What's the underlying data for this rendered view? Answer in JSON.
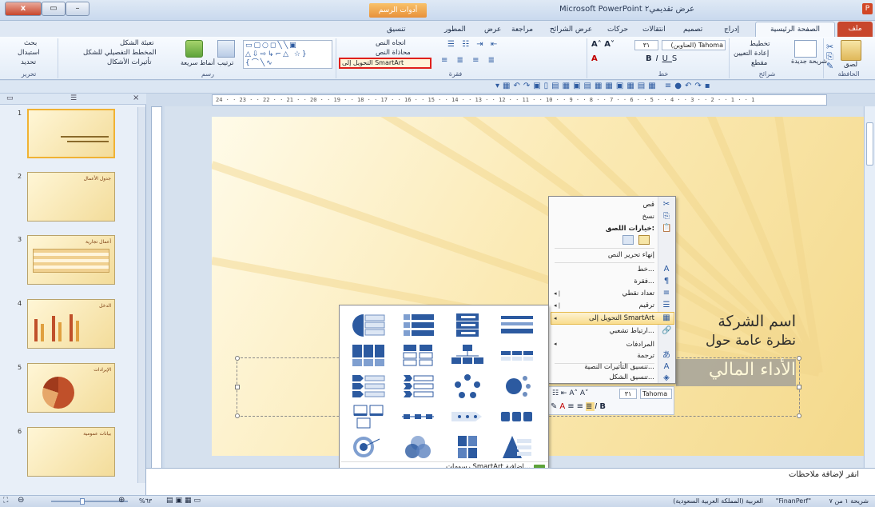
{
  "window": {
    "app_title": "Microsoft PowerPoint   عرض تقديمي٢",
    "context_tab": "أدوات الرسم",
    "logo": "P",
    "controls": [
      "x",
      "▭",
      "–"
    ]
  },
  "tabs": [
    {
      "id": "file",
      "label": "ملف"
    },
    {
      "id": "home",
      "label": "الصفحة الرئيسية"
    },
    {
      "id": "insert",
      "label": "إدراج"
    },
    {
      "id": "design",
      "label": "تصميم"
    },
    {
      "id": "transitions",
      "label": "انتقالات"
    },
    {
      "id": "animations",
      "label": "حركات"
    },
    {
      "id": "slideshow",
      "label": "عرض الشرائح"
    },
    {
      "id": "review",
      "label": "مراجعة"
    },
    {
      "id": "view",
      "label": "عرض"
    },
    {
      "id": "developer",
      "label": "المطور"
    },
    {
      "id": "format",
      "label": "تنسيق"
    }
  ],
  "ribbon": {
    "clipboard": {
      "group": "الحافظة",
      "paste": "لصق"
    },
    "slides": {
      "group": "شرائح",
      "new_slide": "شريحة جديدة",
      "layout": "تخطيط",
      "reset": "إعادة التعيين",
      "section": "مقطع"
    },
    "font": {
      "group": "خط",
      "font_name": "(العناوين) Tahoma",
      "font_size": "٣١"
    },
    "paragraph": {
      "group": "فقرة",
      "text_direction": "اتجاه النص",
      "align_text": "محاذاة النص",
      "convert_smartart": "التحويل إلى SmartArt"
    },
    "drawing": {
      "group": "رسم",
      "arrange": "ترتيب",
      "quick_styles": "أنماط سريعة",
      "fill": "تعبئة الشكل",
      "outline": "المخطط التفصيلي للشكل",
      "effects": "تأثيرات الأشكال"
    },
    "editing": {
      "group": "تحرير",
      "find": "بحث",
      "replace": "استبدال",
      "select": "تحديد"
    }
  },
  "ruler_text": "24 · · 23 · · 22 · · 21 · · 20 · · 19 · · 18 · · 17 · · 16 · · 15 · · 14 · · 13 · · 12 · · 11 · · 10 · · 9 · · 8 · · 7 · · 6 · · 5 · · 4 · · 3 · · 2 · · 1 · · 1",
  "slides_pane": {
    "thumbs": [
      {
        "num": "1",
        "title": "",
        "selected": true
      },
      {
        "num": "2",
        "title": "جدول الأعمال"
      },
      {
        "num": "3",
        "title": "أعمال تجارية"
      },
      {
        "num": "4",
        "title": "الدخل"
      },
      {
        "num": "5",
        "title": "الإيرادات"
      },
      {
        "num": "6",
        "title": "بيانات عمومية"
      }
    ]
  },
  "slide": {
    "line1": "اسم الشركة",
    "line2": "نظرة عامة حول",
    "line3": "الأداء المالي"
  },
  "context_menu": {
    "items": [
      {
        "label": "قص",
        "icon": "✂"
      },
      {
        "label": "نسخ",
        "icon": "⎘"
      },
      {
        "label": "خيارات اللصق:",
        "icon": "📋"
      },
      {
        "label": "إنهاء تحرير النص",
        "icon": ""
      },
      {
        "label": "خط...",
        "icon": "A"
      },
      {
        "label": "فقرة...",
        "icon": "¶"
      },
      {
        "label": "تعداد نقطي",
        "icon": "≡"
      },
      {
        "label": "ترقيم",
        "icon": "☰"
      },
      {
        "label": "التحويل إلى SmartArt",
        "icon": "▦"
      },
      {
        "label": "ارتباط تشعبي...",
        "icon": "🔗"
      },
      {
        "label": "المرادفات",
        "icon": ""
      },
      {
        "label": "ترجمة",
        "icon": "あ"
      },
      {
        "label": "تنسيق التأثيرات النصية...",
        "icon": "A"
      },
      {
        "label": "تنسيق الشكل...",
        "icon": "◈"
      }
    ]
  },
  "smartart_gallery": {
    "more_label": "رسومات SmartArt إضافية..."
  },
  "mini_toolbar": {
    "font": "Tahoma (",
    "size": "٣١"
  },
  "notes": {
    "placeholder": "انقر لإضافة ملاحظات"
  },
  "status": {
    "slide_info": "شريحة ١ من ٧",
    "theme": "\"FinanPerf\"",
    "language": "العربية (المملكة العربية السعودية)",
    "zoom": "%٦٣"
  },
  "colors": {
    "accent": "#e0201b",
    "ribbon_bg": "#e3ecf7",
    "slide_bg": "#f4d98b",
    "file_tab": "#c8462c"
  }
}
